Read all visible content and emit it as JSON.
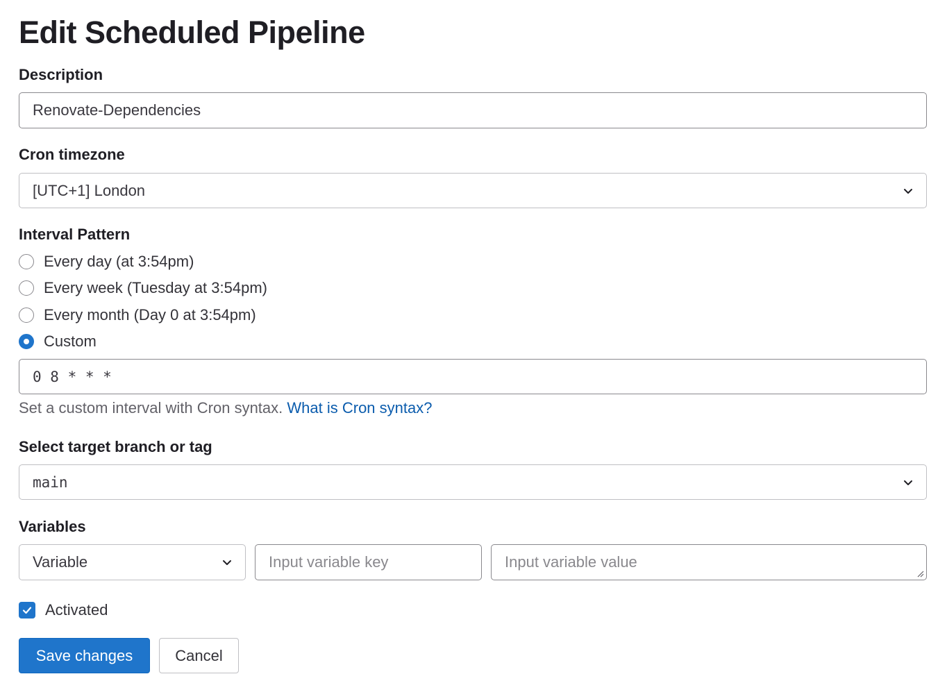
{
  "page": {
    "title": "Edit Scheduled Pipeline"
  },
  "description": {
    "label": "Description",
    "value": "Renovate-Dependencies"
  },
  "timezone": {
    "label": "Cron timezone",
    "value": "[UTC+1] London"
  },
  "interval": {
    "label": "Interval Pattern",
    "options": [
      {
        "label": "Every day (at 3:54pm)",
        "checked": false
      },
      {
        "label": "Every week (Tuesday at 3:54pm)",
        "checked": false
      },
      {
        "label": "Every month (Day 0 at 3:54pm)",
        "checked": false
      },
      {
        "label": "Custom",
        "checked": true
      }
    ],
    "custom_value": "0 8 * * *",
    "help_text": "Set a custom interval with Cron syntax.",
    "help_link": "What is Cron syntax?"
  },
  "branch": {
    "label": "Select target branch or tag",
    "value": "main"
  },
  "variables": {
    "label": "Variables",
    "type_value": "Variable",
    "key_placeholder": "Input variable key",
    "value_placeholder": "Input variable value"
  },
  "activated": {
    "label": "Activated",
    "checked": true
  },
  "actions": {
    "save_label": "Save changes",
    "cancel_label": "Cancel"
  },
  "colors": {
    "primary": "#1f75cb",
    "link": "#0b5cad",
    "text": "#1f1e24",
    "border": "#89888d"
  }
}
